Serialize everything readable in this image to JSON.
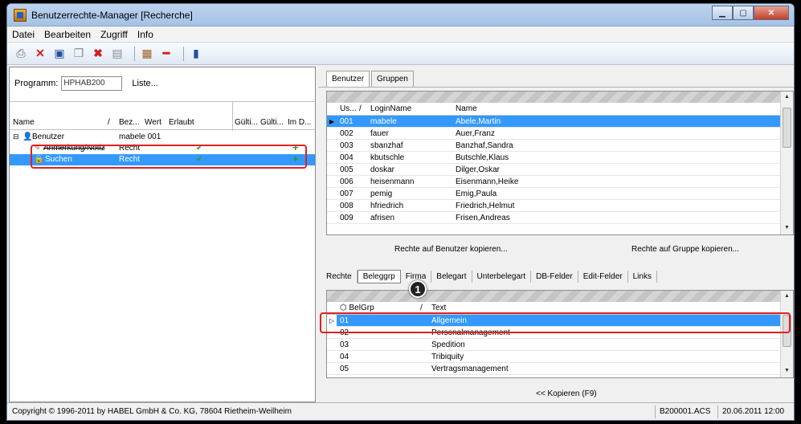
{
  "window": {
    "title": "Benutzerrechte-Manager [Recherche]"
  },
  "menu": [
    "Datei",
    "Bearbeiten",
    "Zugriff",
    "Info"
  ],
  "toolbar_icons": [
    "print-icon",
    "delete-icon",
    "save-icon",
    "copy-icon",
    "cancel-icon",
    "document-icon",
    "grid-icon",
    "minus-icon",
    "exit-icon"
  ],
  "left": {
    "program_label": "Programm:",
    "program_value": "HPHAB200",
    "list_button": "Liste...",
    "columns": [
      "Name",
      "/",
      "Bez...",
      "Wert",
      "Erlaubt",
      "Gülti...",
      "Gülti...",
      "Im D..."
    ],
    "tree": [
      {
        "name": "Benutzer",
        "bez": "mabele 001",
        "erlaubt": "",
        "im": ""
      },
      {
        "name": "Anmerkung/Notiz",
        "bez": "Recht",
        "erlaubt": "✔",
        "im": "+"
      },
      {
        "name": "Suchen",
        "bez": "Recht",
        "erlaubt": "✔",
        "im": "+"
      }
    ]
  },
  "right": {
    "tabs": [
      "Benutzer",
      "Gruppen"
    ],
    "users_columns": [
      "Us...",
      "/",
      "LoginName",
      "Name"
    ],
    "users": [
      {
        "nr": "001",
        "login": "mabele",
        "name": "Abele,Martin"
      },
      {
        "nr": "002",
        "login": "fauer",
        "name": "Auer,Franz"
      },
      {
        "nr": "003",
        "login": "sbanzhaf",
        "name": "Banzhaf,Sandra"
      },
      {
        "nr": "004",
        "login": "kbutschle",
        "name": "Butschle,Klaus"
      },
      {
        "nr": "005",
        "login": "doskar",
        "name": "Dilger,Oskar"
      },
      {
        "nr": "006",
        "login": "heisenmann",
        "name": "Eisenmann,Heike"
      },
      {
        "nr": "007",
        "login": "pemig",
        "name": "Emig,Paula"
      },
      {
        "nr": "008",
        "login": "hfriedrich",
        "name": "Friedrich,Helmut"
      },
      {
        "nr": "009",
        "login": "afrisen",
        "name": "Frisen,Andreas"
      }
    ],
    "copy_user": "Rechte auf Benutzer kopieren...",
    "copy_group": "Rechte auf Gruppe kopieren...",
    "subtabs": [
      "Rechte",
      "Beleggrp",
      "Firma",
      "Belegart",
      "Unterbelegart",
      "DB-Felder",
      "Edit-Felder",
      "Links"
    ],
    "bel_columns": [
      "BelGrp",
      "/",
      "Text"
    ],
    "belgrp": [
      {
        "nr": "01",
        "text": "Allgemein"
      },
      {
        "nr": "02",
        "text": "Personalmanagement"
      },
      {
        "nr": "03",
        "text": "Spedition"
      },
      {
        "nr": "04",
        "text": "Tribiquity"
      },
      {
        "nr": "05",
        "text": "Vertragsmanagement"
      }
    ],
    "copy_button": "<< Kopieren (F9)",
    "badge": "1"
  },
  "status": {
    "copyright": "Copyright © 1996-2011 by HABEL GmbH & Co. KG, 78604 Rietheim-Weilheim",
    "file": "B200001.ACS",
    "datetime": "20.06.2011 12:00"
  }
}
